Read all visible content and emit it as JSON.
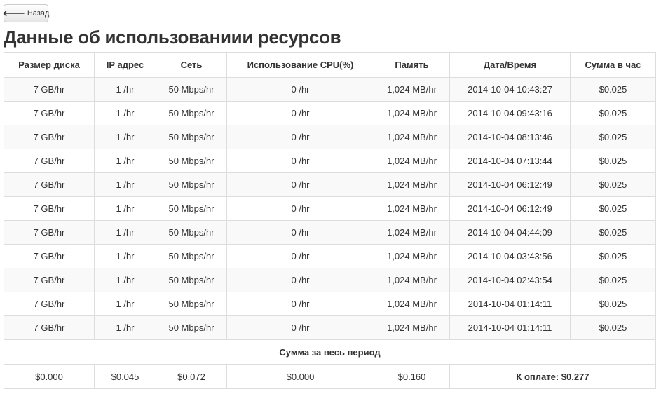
{
  "back_button": {
    "label": "Назад",
    "icon": "arrow-left-icon"
  },
  "page_title": "Данные об использованиии ресурсов",
  "table": {
    "headers": [
      "Размер диска",
      "IP адрес",
      "Сеть",
      "Использование CPU(%)",
      "Память",
      "Дата/Время",
      "Сумма в час"
    ],
    "rows": [
      [
        "7 GB/hr",
        "1 /hr",
        "50 Mbps/hr",
        "0 /hr",
        "1,024 MB/hr",
        "2014-10-04 10:43:27",
        "$0.025"
      ],
      [
        "7 GB/hr",
        "1 /hr",
        "50 Mbps/hr",
        "0 /hr",
        "1,024 MB/hr",
        "2014-10-04 09:43:16",
        "$0.025"
      ],
      [
        "7 GB/hr",
        "1 /hr",
        "50 Mbps/hr",
        "0 /hr",
        "1,024 MB/hr",
        "2014-10-04 08:13:46",
        "$0.025"
      ],
      [
        "7 GB/hr",
        "1 /hr",
        "50 Mbps/hr",
        "0 /hr",
        "1,024 MB/hr",
        "2014-10-04 07:13:44",
        "$0.025"
      ],
      [
        "7 GB/hr",
        "1 /hr",
        "50 Mbps/hr",
        "0 /hr",
        "1,024 MB/hr",
        "2014-10-04 06:12:49",
        "$0.025"
      ],
      [
        "7 GB/hr",
        "1 /hr",
        "50 Mbps/hr",
        "0 /hr",
        "1,024 MB/hr",
        "2014-10-04 06:12:49",
        "$0.025"
      ],
      [
        "7 GB/hr",
        "1 /hr",
        "50 Mbps/hr",
        "0 /hr",
        "1,024 MB/hr",
        "2014-10-04 04:44:09",
        "$0.025"
      ],
      [
        "7 GB/hr",
        "1 /hr",
        "50 Mbps/hr",
        "0 /hr",
        "1,024 MB/hr",
        "2014-10-04 03:43:56",
        "$0.025"
      ],
      [
        "7 GB/hr",
        "1 /hr",
        "50 Mbps/hr",
        "0 /hr",
        "1,024 MB/hr",
        "2014-10-04 02:43:54",
        "$0.025"
      ],
      [
        "7 GB/hr",
        "1 /hr",
        "50 Mbps/hr",
        "0 /hr",
        "1,024 MB/hr",
        "2014-10-04 01:14:11",
        "$0.025"
      ],
      [
        "7 GB/hr",
        "1 /hr",
        "50 Mbps/hr",
        "0 /hr",
        "1,024 MB/hr",
        "2014-10-04 01:14:11",
        "$0.025"
      ]
    ],
    "summary_title": "Сумма за весь период",
    "summary": {
      "disk": "$0.000",
      "ip": "$0.045",
      "network": "$0.072",
      "cpu": "$0.000",
      "memory": "$0.160",
      "total": "К оплате: $0.277"
    }
  }
}
